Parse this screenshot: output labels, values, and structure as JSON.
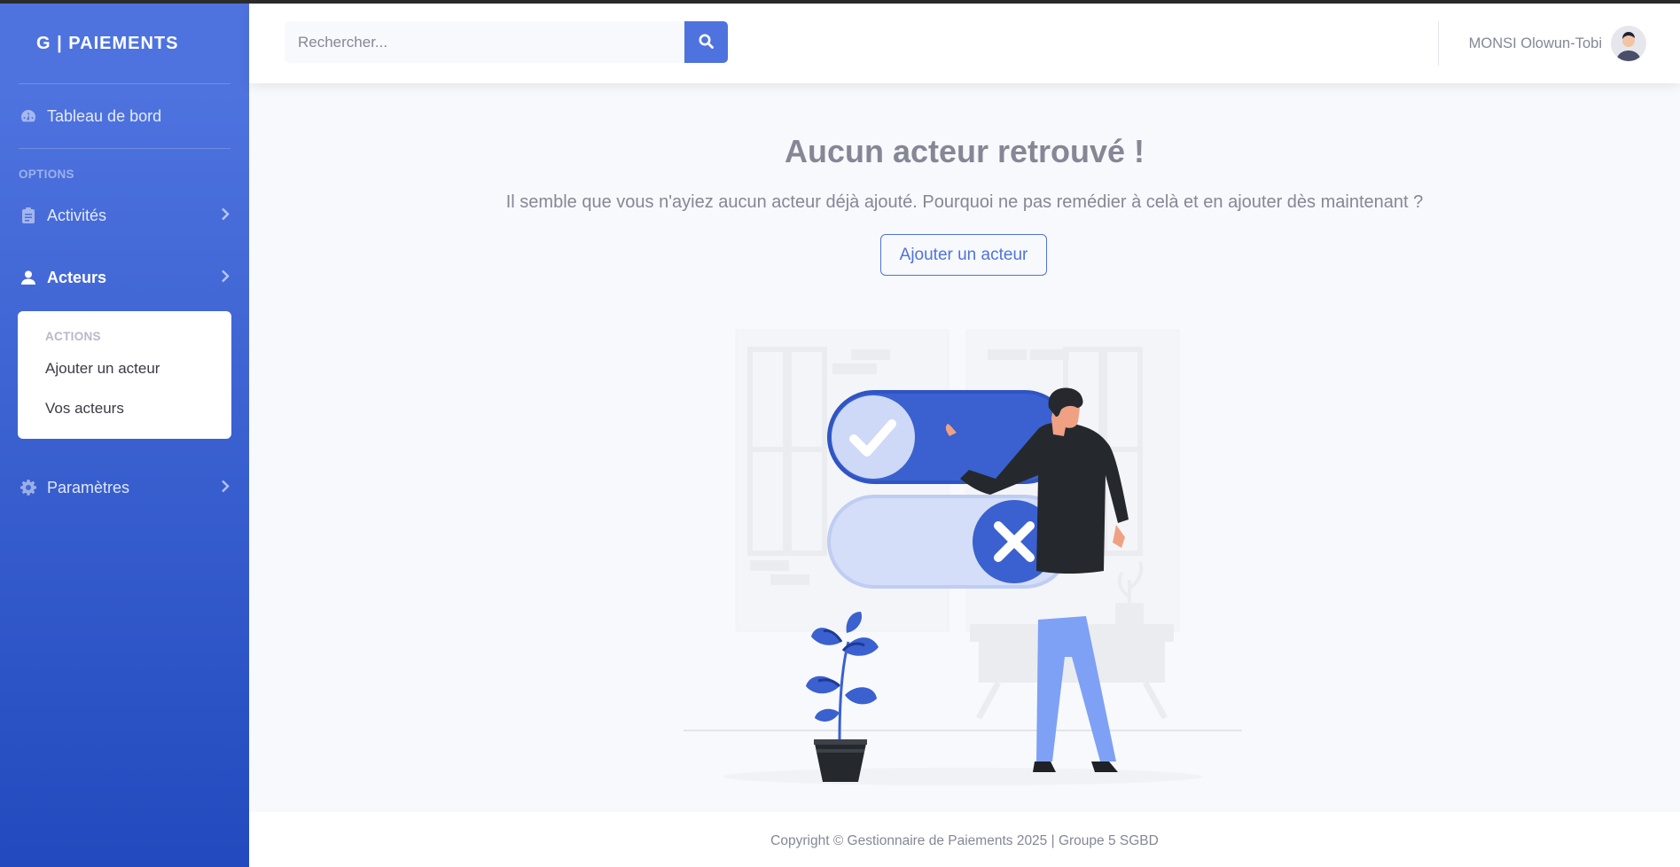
{
  "sidebar": {
    "brand": "G | PAIEMENTS",
    "dashboard_label": "Tableau de bord",
    "options_heading": "OPTIONS",
    "items": [
      {
        "label": "Activités",
        "icon": "clipboard-icon"
      },
      {
        "label": "Acteurs",
        "icon": "user-icon"
      },
      {
        "label": "Paramètres",
        "icon": "gear-icon"
      }
    ],
    "submenu": {
      "heading": "ACTIONS",
      "items": [
        "Ajouter un acteur",
        "Vos acteurs"
      ]
    }
  },
  "topbar": {
    "search_placeholder": "Rechercher...",
    "user_name": "MONSI Olowun-Tobi"
  },
  "main": {
    "title": "Aucun acteur retrouvé !",
    "subtitle": "Il semble que vous n'ayiez aucun acteur déjà ajouté. Pourquoi ne pas remédier à celà et en ajouter dès maintenant ?",
    "add_button": "Ajouter un acteur"
  },
  "footer": {
    "text": "Copyright © Gestionnaire de Paiements 2025 | Groupe 5 SGBD"
  },
  "colors": {
    "primary": "#4e73df",
    "sidebar_dark": "#224abe",
    "text_muted": "#858796"
  }
}
